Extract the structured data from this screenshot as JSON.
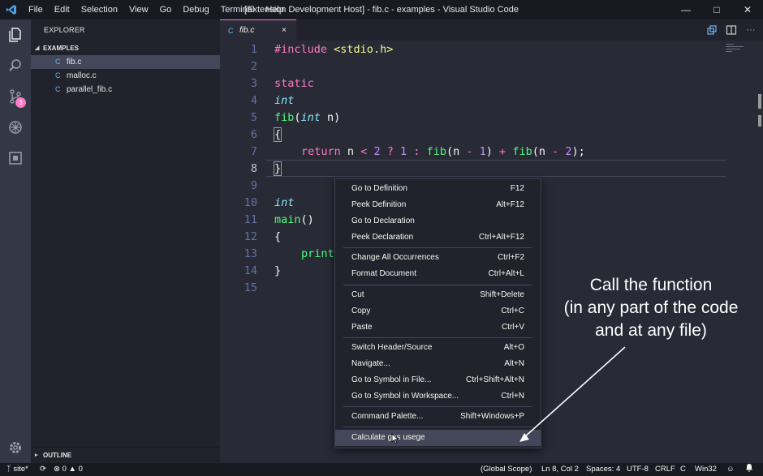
{
  "titlebar": {
    "menu": [
      "File",
      "Edit",
      "Selection",
      "View",
      "Go",
      "Debug",
      "Terminal",
      "Help"
    ],
    "window_title": "[Extension Development Host] - fib.c - examples - Visual Studio Code"
  },
  "activity": {
    "scm_badge": "3"
  },
  "sidebar": {
    "title": "EXPLORER",
    "section": "EXAMPLES",
    "files": [
      {
        "icon": "C",
        "name": "fib.c"
      },
      {
        "icon": "C",
        "name": "malloc.c"
      },
      {
        "icon": "C",
        "name": "parallel_fib.c"
      }
    ],
    "outline": "OUTLINE"
  },
  "tab": {
    "icon": "C",
    "name": "fib.c",
    "close": "×"
  },
  "editor": {
    "line_numbers": [
      "1",
      "2",
      "3",
      "4",
      "5",
      "6",
      "7",
      "8",
      "9",
      "10",
      "11",
      "12",
      "13",
      "14",
      "15"
    ],
    "l1_kw": "#include",
    "l1_hdr": "<stdio.h>",
    "l3_kw": "static",
    "l4_ty": "int",
    "l5_fn": "fib",
    "l5_p1": "(",
    "l5_ty": "int",
    "l5_p2": " n)",
    "l6": "{",
    "l7_ret": "return",
    "l7_a": " n ",
    "l7_lt": "<",
    "l7_sp1": " ",
    "l7_two1": "2",
    "l7_sp2": " ",
    "l7_q": "?",
    "l7_sp3": " ",
    "l7_one": "1",
    "l7_sp4": " ",
    "l7_colon": ":",
    "l7_sp5": " ",
    "l7_fib1": "fib",
    "l7_b": "(n ",
    "l7_m1": "-",
    "l7_sp6": " ",
    "l7_one2": "1",
    "l7_c": ") ",
    "l7_plus": "+",
    "l7_sp7": " ",
    "l7_fib2": "fib",
    "l7_d": "(n ",
    "l7_m2": "-",
    "l7_sp8": " ",
    "l7_two2": "2",
    "l7_e": ");",
    "l8": "}",
    "l10_ty": "int",
    "l11_fn": "main",
    "l11_p": "()",
    "l12": "{",
    "l13_fn": "print",
    "l14": "}"
  },
  "context_menu": {
    "items": [
      {
        "label": "Go to Definition",
        "shortcut": "F12"
      },
      {
        "label": "Peek Definition",
        "shortcut": "Alt+F12"
      },
      {
        "label": "Go to Declaration",
        "shortcut": ""
      },
      {
        "label": "Peek Declaration",
        "shortcut": "Ctrl+Alt+F12"
      },
      {
        "label": "Change All Occurrences",
        "shortcut": "Ctrl+F2"
      },
      {
        "label": "Format Document",
        "shortcut": "Ctrl+Alt+L"
      },
      {
        "label": "Cut",
        "shortcut": "Shift+Delete"
      },
      {
        "label": "Copy",
        "shortcut": "Ctrl+C"
      },
      {
        "label": "Paste",
        "shortcut": "Ctrl+V"
      },
      {
        "label": "Switch Header/Source",
        "shortcut": "Alt+O"
      },
      {
        "label": "Navigate...",
        "shortcut": "Alt+N"
      },
      {
        "label": "Go to Symbol in File...",
        "shortcut": "Ctrl+Shift+Alt+N"
      },
      {
        "label": "Go to Symbol in Workspace...",
        "shortcut": "Ctrl+N"
      },
      {
        "label": "Command Palette...",
        "shortcut": "Shift+Windows+P"
      },
      {
        "label": "Calculate gas usege",
        "shortcut": ""
      }
    ],
    "highlighted_item": "Calculate gas usege"
  },
  "annotation": {
    "text": "Call the function\n(in any part of the code\nand at any file)"
  },
  "statusbar": {
    "branch": "site*",
    "errors": "0",
    "warnings": "0",
    "scope": "(Global Scope)",
    "position": "Ln 8, Col 2",
    "spaces": "Spaces: 4",
    "encoding": "UTF-8",
    "eol": "CRLF",
    "language": "C",
    "platform": "Win32"
  },
  "colors": {
    "accent": "#ff79c6",
    "background": "#282a36",
    "sidebar": "#21222c",
    "activity_bar": "#343746",
    "status_bar": "#191a21"
  }
}
